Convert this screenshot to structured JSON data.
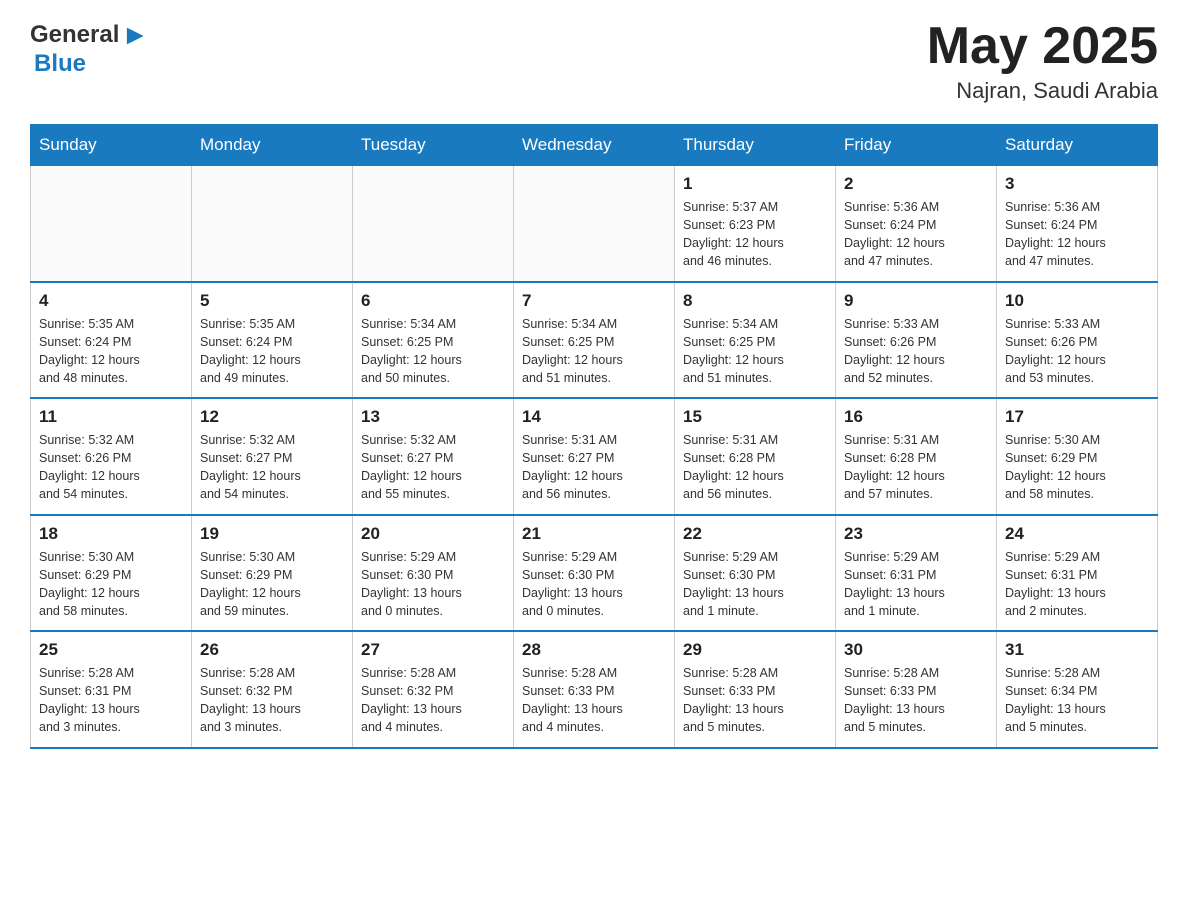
{
  "header": {
    "logo_general": "General",
    "logo_blue": "Blue",
    "main_title": "May 2025",
    "subtitle": "Najran, Saudi Arabia"
  },
  "days_of_week": [
    "Sunday",
    "Monday",
    "Tuesday",
    "Wednesday",
    "Thursday",
    "Friday",
    "Saturday"
  ],
  "weeks": [
    [
      {
        "day": "",
        "info": ""
      },
      {
        "day": "",
        "info": ""
      },
      {
        "day": "",
        "info": ""
      },
      {
        "day": "",
        "info": ""
      },
      {
        "day": "1",
        "info": "Sunrise: 5:37 AM\nSunset: 6:23 PM\nDaylight: 12 hours\nand 46 minutes."
      },
      {
        "day": "2",
        "info": "Sunrise: 5:36 AM\nSunset: 6:24 PM\nDaylight: 12 hours\nand 47 minutes."
      },
      {
        "day": "3",
        "info": "Sunrise: 5:36 AM\nSunset: 6:24 PM\nDaylight: 12 hours\nand 47 minutes."
      }
    ],
    [
      {
        "day": "4",
        "info": "Sunrise: 5:35 AM\nSunset: 6:24 PM\nDaylight: 12 hours\nand 48 minutes."
      },
      {
        "day": "5",
        "info": "Sunrise: 5:35 AM\nSunset: 6:24 PM\nDaylight: 12 hours\nand 49 minutes."
      },
      {
        "day": "6",
        "info": "Sunrise: 5:34 AM\nSunset: 6:25 PM\nDaylight: 12 hours\nand 50 minutes."
      },
      {
        "day": "7",
        "info": "Sunrise: 5:34 AM\nSunset: 6:25 PM\nDaylight: 12 hours\nand 51 minutes."
      },
      {
        "day": "8",
        "info": "Sunrise: 5:34 AM\nSunset: 6:25 PM\nDaylight: 12 hours\nand 51 minutes."
      },
      {
        "day": "9",
        "info": "Sunrise: 5:33 AM\nSunset: 6:26 PM\nDaylight: 12 hours\nand 52 minutes."
      },
      {
        "day": "10",
        "info": "Sunrise: 5:33 AM\nSunset: 6:26 PM\nDaylight: 12 hours\nand 53 minutes."
      }
    ],
    [
      {
        "day": "11",
        "info": "Sunrise: 5:32 AM\nSunset: 6:26 PM\nDaylight: 12 hours\nand 54 minutes."
      },
      {
        "day": "12",
        "info": "Sunrise: 5:32 AM\nSunset: 6:27 PM\nDaylight: 12 hours\nand 54 minutes."
      },
      {
        "day": "13",
        "info": "Sunrise: 5:32 AM\nSunset: 6:27 PM\nDaylight: 12 hours\nand 55 minutes."
      },
      {
        "day": "14",
        "info": "Sunrise: 5:31 AM\nSunset: 6:27 PM\nDaylight: 12 hours\nand 56 minutes."
      },
      {
        "day": "15",
        "info": "Sunrise: 5:31 AM\nSunset: 6:28 PM\nDaylight: 12 hours\nand 56 minutes."
      },
      {
        "day": "16",
        "info": "Sunrise: 5:31 AM\nSunset: 6:28 PM\nDaylight: 12 hours\nand 57 minutes."
      },
      {
        "day": "17",
        "info": "Sunrise: 5:30 AM\nSunset: 6:29 PM\nDaylight: 12 hours\nand 58 minutes."
      }
    ],
    [
      {
        "day": "18",
        "info": "Sunrise: 5:30 AM\nSunset: 6:29 PM\nDaylight: 12 hours\nand 58 minutes."
      },
      {
        "day": "19",
        "info": "Sunrise: 5:30 AM\nSunset: 6:29 PM\nDaylight: 12 hours\nand 59 minutes."
      },
      {
        "day": "20",
        "info": "Sunrise: 5:29 AM\nSunset: 6:30 PM\nDaylight: 13 hours\nand 0 minutes."
      },
      {
        "day": "21",
        "info": "Sunrise: 5:29 AM\nSunset: 6:30 PM\nDaylight: 13 hours\nand 0 minutes."
      },
      {
        "day": "22",
        "info": "Sunrise: 5:29 AM\nSunset: 6:30 PM\nDaylight: 13 hours\nand 1 minute."
      },
      {
        "day": "23",
        "info": "Sunrise: 5:29 AM\nSunset: 6:31 PM\nDaylight: 13 hours\nand 1 minute."
      },
      {
        "day": "24",
        "info": "Sunrise: 5:29 AM\nSunset: 6:31 PM\nDaylight: 13 hours\nand 2 minutes."
      }
    ],
    [
      {
        "day": "25",
        "info": "Sunrise: 5:28 AM\nSunset: 6:31 PM\nDaylight: 13 hours\nand 3 minutes."
      },
      {
        "day": "26",
        "info": "Sunrise: 5:28 AM\nSunset: 6:32 PM\nDaylight: 13 hours\nand 3 minutes."
      },
      {
        "day": "27",
        "info": "Sunrise: 5:28 AM\nSunset: 6:32 PM\nDaylight: 13 hours\nand 4 minutes."
      },
      {
        "day": "28",
        "info": "Sunrise: 5:28 AM\nSunset: 6:33 PM\nDaylight: 13 hours\nand 4 minutes."
      },
      {
        "day": "29",
        "info": "Sunrise: 5:28 AM\nSunset: 6:33 PM\nDaylight: 13 hours\nand 5 minutes."
      },
      {
        "day": "30",
        "info": "Sunrise: 5:28 AM\nSunset: 6:33 PM\nDaylight: 13 hours\nand 5 minutes."
      },
      {
        "day": "31",
        "info": "Sunrise: 5:28 AM\nSunset: 6:34 PM\nDaylight: 13 hours\nand 5 minutes."
      }
    ]
  ]
}
